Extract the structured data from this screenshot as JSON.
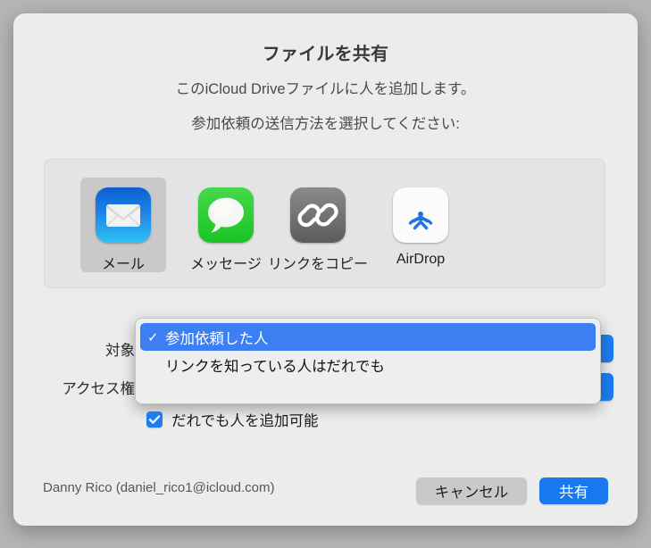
{
  "dialog": {
    "title": "ファイルを共有",
    "subtitle1": "このiCloud Driveファイルに人を追加します。",
    "subtitle2": "参加依頼の送信方法を選択してください:"
  },
  "share_methods": [
    {
      "id": "mail",
      "label": "メール",
      "icon": "mail-icon",
      "selected": true
    },
    {
      "id": "message",
      "label": "メッセージ",
      "icon": "messages-icon",
      "selected": false
    },
    {
      "id": "link",
      "label": "リンクをコピー",
      "icon": "link-icon",
      "selected": false
    },
    {
      "id": "airdrop",
      "label": "AirDrop",
      "icon": "airdrop-icon",
      "selected": false
    }
  ],
  "fields": {
    "audience_label": "対象",
    "permission_label": "アクセス権"
  },
  "audience_menu": {
    "open": true,
    "items": [
      {
        "label": "参加依頼した人",
        "checked": true
      },
      {
        "label": "リンクを知っている人はだれでも",
        "checked": false
      }
    ],
    "check_glyph": "✓"
  },
  "add_people_checkbox": {
    "label": "だれでも人を追加可能",
    "checked": true
  },
  "footer": {
    "account": "Danny Rico (daniel_rico1@icloud.com)",
    "cancel_label": "キャンセル",
    "share_label": "共有"
  },
  "colors": {
    "accent_blue": "#1878f0",
    "menu_highlight": "#3b7ff2",
    "window_background": "#ececec",
    "desktop_background": "#b5b5b5",
    "panel_background": "#e4e4e4",
    "cancel_button": "#c9c9c9"
  }
}
